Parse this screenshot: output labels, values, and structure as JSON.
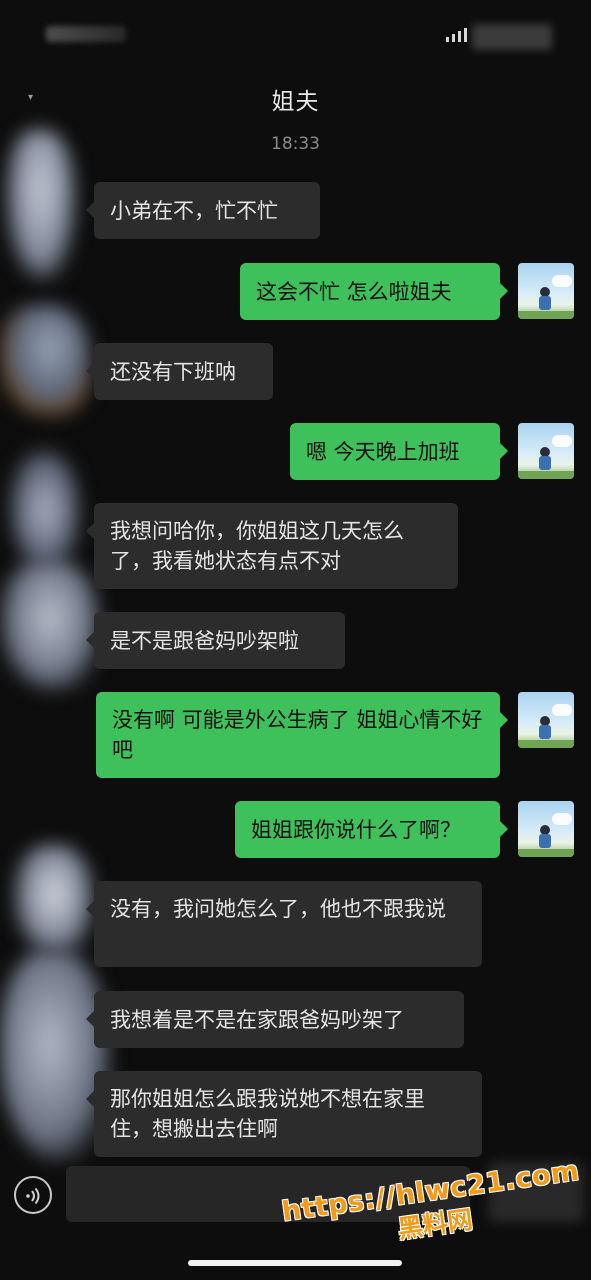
{
  "header": {
    "title": "姐夫"
  },
  "time_separator": "18:33",
  "messages": [
    {
      "side": "in",
      "text": "小弟在不，忙不忙"
    },
    {
      "side": "out",
      "text": "这会不忙 怎么啦姐夫"
    },
    {
      "side": "in",
      "text": "还没有下班呐"
    },
    {
      "side": "out",
      "text": "嗯 今天晚上加班"
    },
    {
      "side": "in",
      "text": "我想问哈你，你姐姐这几天怎么了，我看她状态有点不对"
    },
    {
      "side": "in",
      "text": "是不是跟爸妈吵架啦"
    },
    {
      "side": "out",
      "text": "没有啊 可能是外公生病了 姐姐心情不好吧"
    },
    {
      "side": "out",
      "text": "姐姐跟你说什么了啊？"
    },
    {
      "side": "in",
      "text": "没有，我问她怎么了，他也不跟我说"
    },
    {
      "side": "in",
      "text": "我想着是不是在家跟爸妈吵架了"
    },
    {
      "side": "in",
      "text": "那你姐姐怎么跟我说她不想在家里住，想搬出去住啊"
    }
  ],
  "watermark": {
    "url": "https://hlwc21.com",
    "name": "黑料网"
  },
  "icons": {
    "voice": "voice-icon",
    "back": "back-icon"
  },
  "colors": {
    "outgoing_bubble": "#3ec15b",
    "incoming_bubble": "#2c2c2c",
    "background": "#0d0d0d",
    "watermark": "#f39a1b"
  }
}
